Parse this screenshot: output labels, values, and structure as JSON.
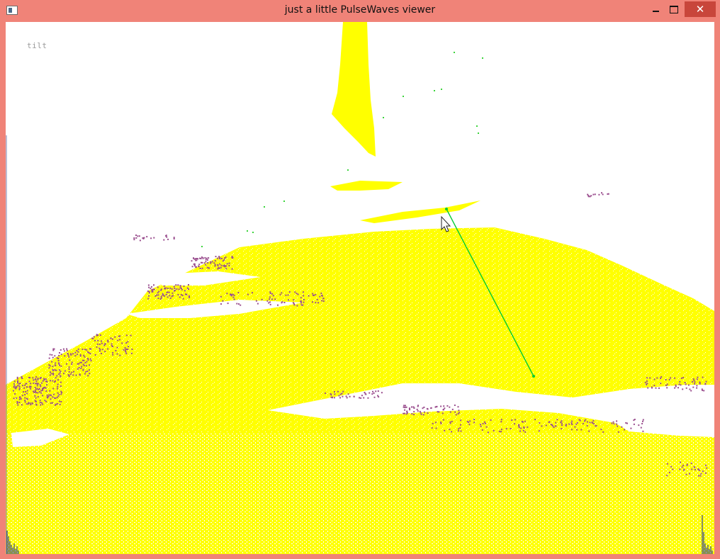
{
  "window": {
    "title": "just a little PulseWaves viewer",
    "close_glyph": "✕",
    "icon": "app-window-icon"
  },
  "viewer": {
    "mode": "tilt",
    "colors": {
      "ground": "#ffff00",
      "noise": "#9b4f8f",
      "sparse": "#3cd43c",
      "selection": "#00cc33",
      "histogram": "#1020a0",
      "frame": "#f08378"
    },
    "cursor": "mouse-pointer-icon"
  }
}
